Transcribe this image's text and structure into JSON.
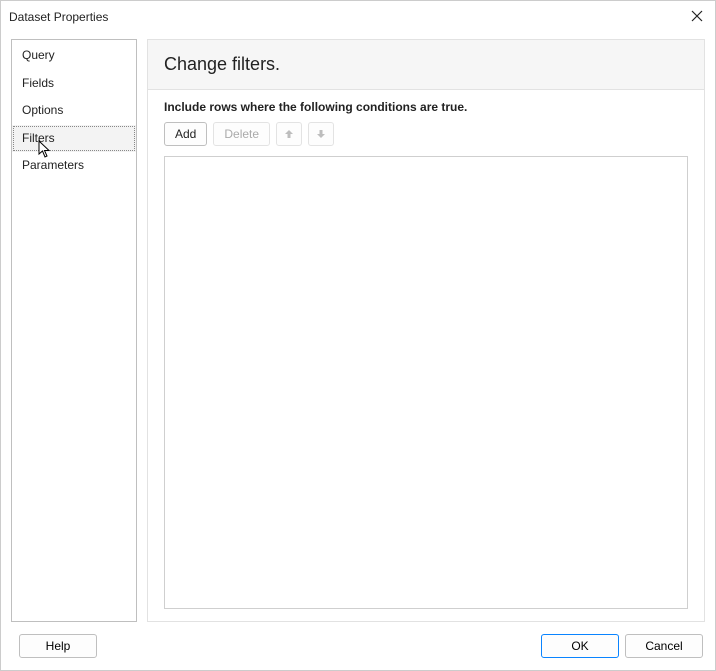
{
  "window": {
    "title": "Dataset Properties"
  },
  "sidebar": {
    "items": [
      {
        "label": "Query",
        "selected": false
      },
      {
        "label": "Fields",
        "selected": false
      },
      {
        "label": "Options",
        "selected": false
      },
      {
        "label": "Filters",
        "selected": true
      },
      {
        "label": "Parameters",
        "selected": false
      }
    ]
  },
  "page": {
    "heading": "Change filters.",
    "instruction": "Include rows where the following conditions are true."
  },
  "toolbar": {
    "add": "Add",
    "delete": "Delete"
  },
  "footer": {
    "help": "Help",
    "ok": "OK",
    "cancel": "Cancel"
  }
}
